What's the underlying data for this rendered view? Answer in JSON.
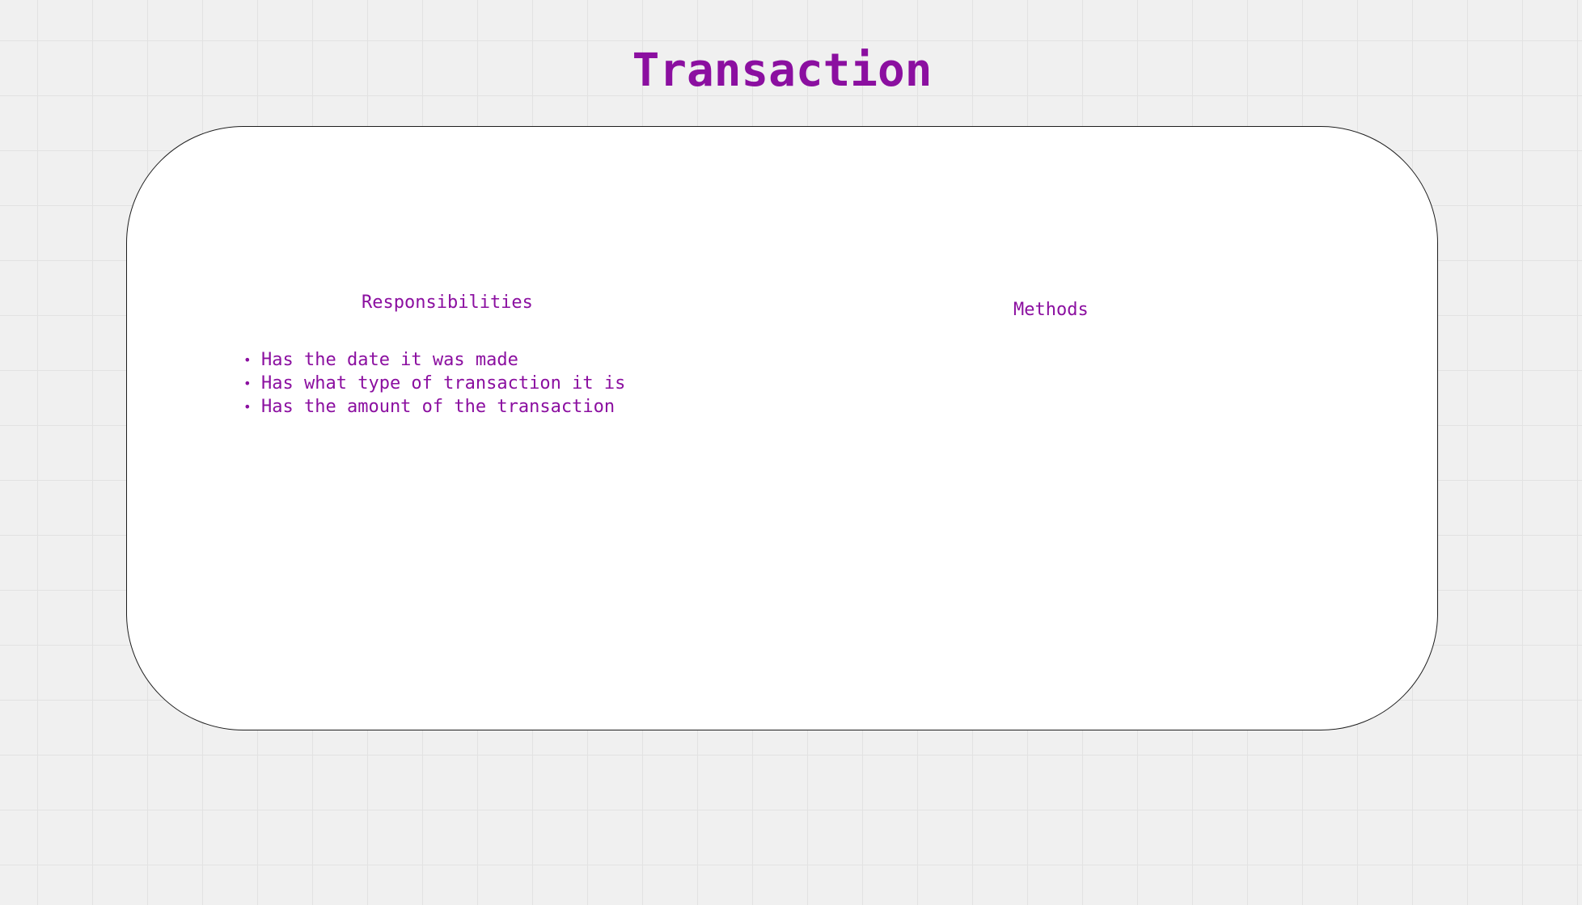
{
  "colors": {
    "accent": "#8b0fa0",
    "card_border": "#1e1e1e",
    "card_fill": "#ffffff",
    "canvas": "#f0f0f0",
    "grid": "#e2e2e2"
  },
  "diagram": {
    "title": "Transaction",
    "card": {
      "responsibilities": {
        "heading": "Responsibilities",
        "items": [
          "Has the date it was made",
          "Has what type of transaction it is",
          "Has the amount of the transaction"
        ]
      },
      "methods": {
        "heading": "Methods"
      }
    }
  },
  "icons": {
    "bullet": "bullet-dot-icon"
  }
}
